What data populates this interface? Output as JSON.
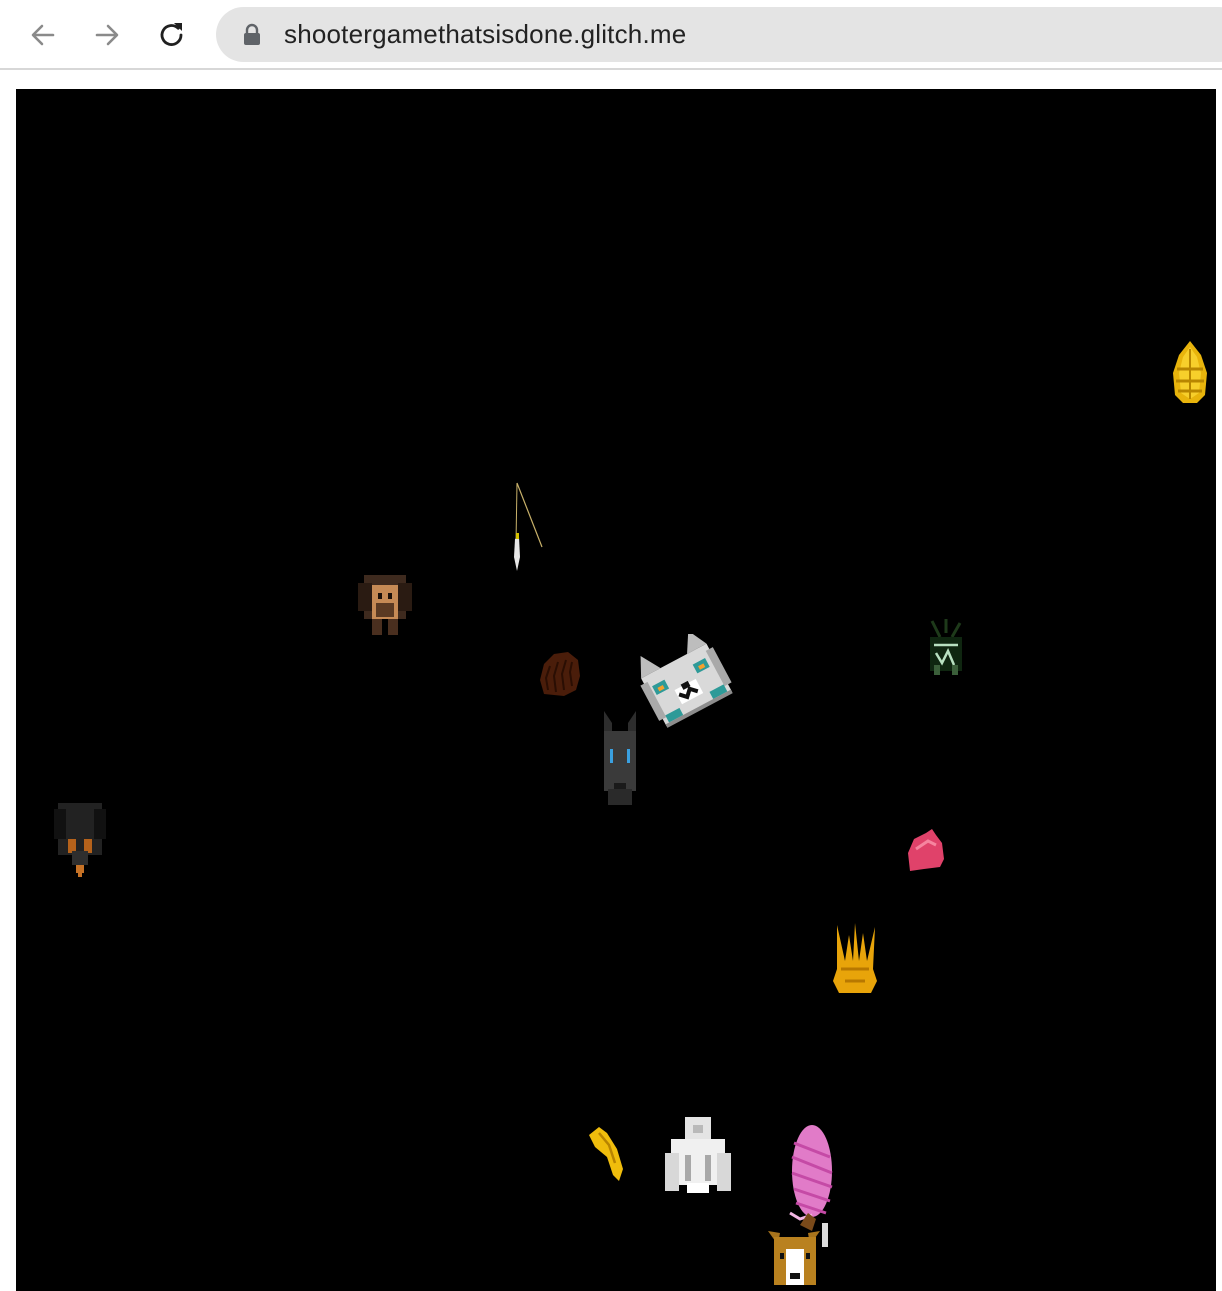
{
  "browser": {
    "url": "shootergamethatsisdone.glitch.me",
    "nav": {
      "back_icon": "arrow-left-icon",
      "forward_icon": "arrow-right-icon",
      "reload_icon": "reload-icon",
      "lock_icon": "lock-icon"
    }
  },
  "game": {
    "background_color": "#000000",
    "sprites": [
      "player-cat",
      "doberman-dog",
      "brown-pug-dog",
      "black-tan-dog",
      "dark-brown-dog",
      "white-dog",
      "corgi-dog",
      "dark-green-creature",
      "pink-blob",
      "gold-crown-flame",
      "gold-shield",
      "yellow-claw",
      "pink-yarn-ball",
      "fishing-rod"
    ]
  }
}
